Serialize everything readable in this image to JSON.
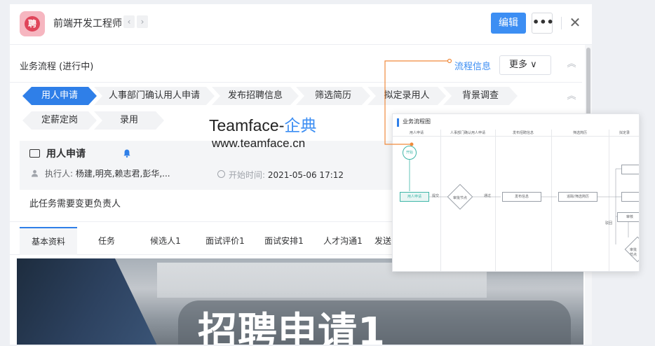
{
  "header": {
    "avatar_text": "聘",
    "title": "前端开发工程师",
    "prev_label": "‹",
    "next_label": "›",
    "edit_label": "编辑",
    "more_label": "•••",
    "close_label": "✕"
  },
  "section": {
    "title": "业务流程 (进行中)",
    "flow_info_label": "流程信息",
    "more_label": "更多 ∨",
    "collapse_label": "︽"
  },
  "steps": [
    {
      "label": "用人申请",
      "active": true
    },
    {
      "label": "人事部门确认用人申请",
      "active": false
    },
    {
      "label": "发布招聘信息",
      "active": false
    },
    {
      "label": "筛选简历",
      "active": false
    },
    {
      "label": "拟定录用人",
      "active": false
    },
    {
      "label": "背景调查",
      "active": false
    },
    {
      "label": "定薪定岗",
      "active": false
    },
    {
      "label": "录用",
      "active": false
    }
  ],
  "watermark": {
    "brand": "Teamface-",
    "brand_accent": "企典",
    "url": "www.teamface.cn"
  },
  "task": {
    "name": "用人申请",
    "executor_label": "执行人:",
    "executor_names": "杨建,明亮,赖志君,彭华,...",
    "start_label": "开始时间:",
    "start_value": "2021-05-06 17:12",
    "description": "此任务需要变更负责人"
  },
  "tabs": [
    {
      "label": "基本资料",
      "active": true
    },
    {
      "label": "任务",
      "active": false
    },
    {
      "label": "候选人1",
      "active": false
    },
    {
      "label": "面试评价1",
      "active": false
    },
    {
      "label": "面试安排1",
      "active": false
    },
    {
      "label": "人才沟通1",
      "active": false
    },
    {
      "label": "发送",
      "active": false
    }
  ],
  "banner": {
    "title": "招聘申请1"
  },
  "flowchart": {
    "title": "业务流程图",
    "columns": [
      "用人申请",
      "人事部门确认用人申请",
      "发布招聘信息",
      "筛选简历",
      "拟定录"
    ],
    "start_label": "开始",
    "node_apply": "用人申请",
    "label_submit": "提交",
    "node_approve": "审批节点",
    "label_pass": "通过",
    "node_publish": "发布信息",
    "node_screen": "追踪/筛选简历",
    "label_reject": "驳回",
    "node_review": "审核",
    "node_approve2": "审批节点"
  },
  "colors": {
    "primary": "#3c8ef3",
    "active_step": "#2f7fe8",
    "connector": "#f08a3c",
    "flow_green": "#3fb6a8"
  }
}
